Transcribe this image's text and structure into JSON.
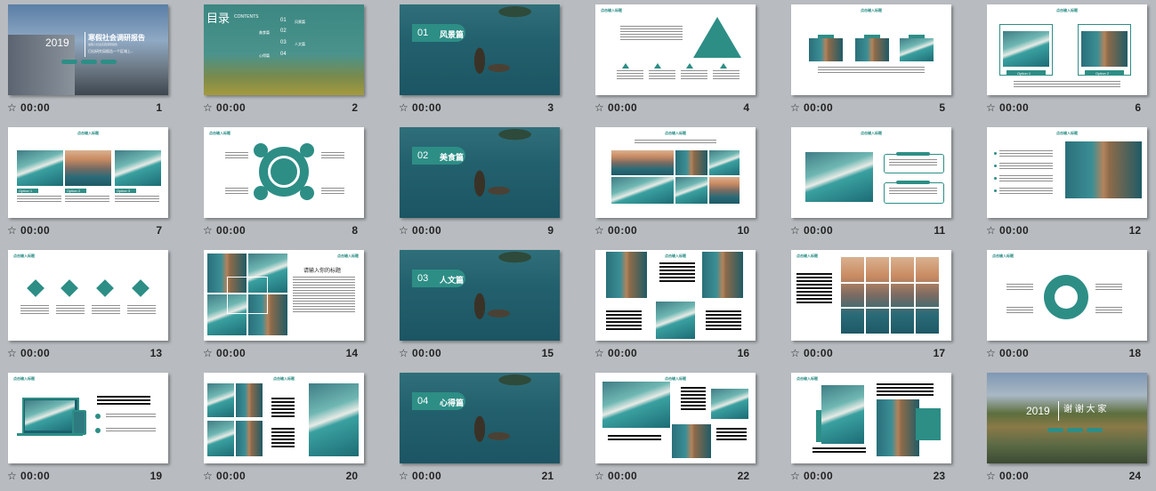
{
  "slides": [
    {
      "num": "1",
      "time": "00:00",
      "year": "2019",
      "title": "寒假社会调研报告",
      "subtitle": "暑假人社会实践调研报告",
      "sub2": "日出研究局报告一个区域上--"
    },
    {
      "num": "2",
      "time": "00:00",
      "toc_title": "目录",
      "toc_sub": "CONTENTS",
      "items": [
        {
          "n": "01",
          "t": "风景篇"
        },
        {
          "n": "02",
          "t": "美食篇"
        },
        {
          "n": "03",
          "t": "人文篇"
        },
        {
          "n": "04",
          "t": "心得篇"
        }
      ]
    },
    {
      "num": "3",
      "time": "00:00",
      "sec_no": "01",
      "sec_title": "风景篇"
    },
    {
      "num": "4",
      "time": "00:00",
      "header": "点击输入标题"
    },
    {
      "num": "5",
      "time": "00:00",
      "header": "点击输入标题"
    },
    {
      "num": "6",
      "time": "00:00",
      "header": "点击输入标题",
      "caption_a": "Option 1",
      "caption_b": "Option 2"
    },
    {
      "num": "7",
      "time": "00:00",
      "header": "点击输入标题",
      "opt1": "Option 1",
      "opt2": "Option 2",
      "opt3": "Option 3"
    },
    {
      "num": "8",
      "time": "00:00",
      "header": "点击输入标题"
    },
    {
      "num": "9",
      "time": "00:00",
      "sec_no": "02",
      "sec_title": "美食篇"
    },
    {
      "num": "10",
      "time": "00:00",
      "header": "点击输入标题"
    },
    {
      "num": "11",
      "time": "00:00",
      "header": "点击输入标题"
    },
    {
      "num": "12",
      "time": "00:00",
      "header": "点击输入标题"
    },
    {
      "num": "13",
      "time": "00:00",
      "header": "点击输入标题"
    },
    {
      "num": "14",
      "time": "00:00",
      "header": "点击输入标题",
      "heading": "请输入你的标题"
    },
    {
      "num": "15",
      "time": "00:00",
      "sec_no": "03",
      "sec_title": "人文篇"
    },
    {
      "num": "16",
      "time": "00:00",
      "header": "点击输入标题"
    },
    {
      "num": "17",
      "time": "00:00",
      "header": "点击输入标题"
    },
    {
      "num": "18",
      "time": "00:00",
      "header": "点击输入标题"
    },
    {
      "num": "19",
      "time": "00:00",
      "header": "点击输入标题"
    },
    {
      "num": "20",
      "time": "00:00",
      "header": "点击输入标题"
    },
    {
      "num": "21",
      "time": "00:00",
      "sec_no": "04",
      "sec_title": "心得篇"
    },
    {
      "num": "22",
      "time": "00:00",
      "header": "点击输入标题"
    },
    {
      "num": "23",
      "time": "00:00",
      "header": "点击输入标题"
    },
    {
      "num": "24",
      "time": "00:00",
      "year": "2019",
      "thanks": "谢 谢 大 家"
    }
  ],
  "star_icon": "☆",
  "colors": {
    "accent": "#2d8e86",
    "background": "#b8bcc0"
  }
}
